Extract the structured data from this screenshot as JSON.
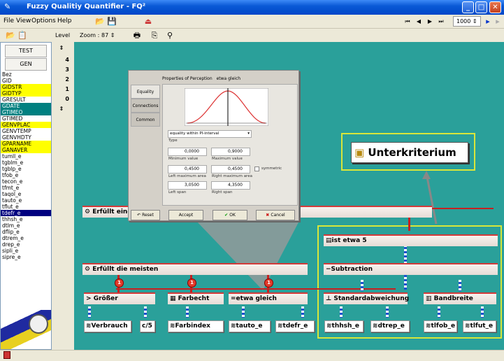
{
  "window": {
    "title": "Fuzzy Qualitiy Quantifier -  FQ²"
  },
  "menu": {
    "items": [
      "File",
      "View",
      "Options",
      "Help"
    ]
  },
  "toolbar": {
    "zoom_label": "Zoom :",
    "zoom_value": "87",
    "counter_value": "1000"
  },
  "left_panel": {
    "level_label": "Level",
    "test_button": "TEST",
    "gen_button": "GEN",
    "items": [
      {
        "label": "Bez",
        "style": "plain"
      },
      {
        "label": "GID",
        "style": "plain"
      },
      {
        "label": "GIDSTR",
        "style": "yellow"
      },
      {
        "label": "GIDTYP",
        "style": "yellow"
      },
      {
        "label": "GRESULT",
        "style": "plain"
      },
      {
        "label": "GDATE",
        "style": "teal"
      },
      {
        "label": "GTIMEO",
        "style": "teal"
      },
      {
        "label": "GTIMED",
        "style": "plain"
      },
      {
        "label": "GENVPLAC",
        "style": "yellow"
      },
      {
        "label": "GENVTEMP",
        "style": "plain"
      },
      {
        "label": "GENVHDTY",
        "style": "plain"
      },
      {
        "label": "GPARNAME",
        "style": "yellow"
      },
      {
        "label": "GANAVER",
        "style": "yellow"
      },
      {
        "label": "tumll_e",
        "style": "plain"
      },
      {
        "label": "tgblm_e",
        "style": "plain"
      },
      {
        "label": "tgblp_e",
        "style": "plain"
      },
      {
        "label": "tfob_e",
        "style": "plain"
      },
      {
        "label": "tecon_e",
        "style": "plain"
      },
      {
        "label": "tfmt_e",
        "style": "plain"
      },
      {
        "label": "taqol_e",
        "style": "plain"
      },
      {
        "label": "tauto_e",
        "style": "plain"
      },
      {
        "label": "tflut_e",
        "style": "plain"
      },
      {
        "label": "tdefr_e",
        "style": "selected"
      },
      {
        "label": "thhsh_e",
        "style": "plain"
      },
      {
        "label": "dtlm_e",
        "style": "plain"
      },
      {
        "label": "dflip_e",
        "style": "plain"
      },
      {
        "label": "dtrem_e",
        "style": "plain"
      },
      {
        "label": "drep_e",
        "style": "plain"
      },
      {
        "label": "sipli_e",
        "style": "plain"
      },
      {
        "label": "sipre_e",
        "style": "plain"
      }
    ],
    "levels": [
      "4",
      "3",
      "2",
      "1",
      "0"
    ]
  },
  "dialog": {
    "header": "Properties of Perception",
    "header_value": "etwa gleich",
    "tabs": [
      "Equality",
      "Connections",
      "Common"
    ],
    "type_select": "equality within PI-interval",
    "type_label": "Type",
    "min_value": "0,0000",
    "max_value": "0,9000",
    "min_label": "Minimum value",
    "max_label": "Maximum value",
    "left_max_area": "0,4500",
    "right_max_area": "0,4500",
    "symmetric_label": "symmetric",
    "left_max_area_label": "Left maximum area",
    "right_max_area_label": "Right maximum area",
    "left_span": "3,0500",
    "right_span": "4,3500",
    "left_span_label": "Left span",
    "right_span_label": "Right span",
    "reset_button": "Reset",
    "accept_button": "Accept",
    "ok_button": "OK",
    "cancel_button": "Cancel"
  },
  "canvas": {
    "unterkriterium": "Unterkriterium",
    "node_erfuellt_eine": "Erfüllt eine",
    "node_erfuellt_meisten": "Erfüllt die meisten",
    "node_ist_etwa": "ist etwa 5",
    "node_subtraction": "Subtraction",
    "node_groesser": "Größer",
    "node_farbecht": "Farbecht",
    "node_etwa_gleich": "etwa gleich",
    "node_std": "Standardabweichung",
    "node_bandbreite": "Bandbreite",
    "leaf_verbrauch": "Verbrauch",
    "leaf_5": "5",
    "leaf_farbindex": "Farbindex",
    "leaf_tauto": "tauto_e",
    "leaf_tdefr": "tdefr_e",
    "leaf_thhsh": "thhsh_e",
    "leaf_dtrep": "dtrep_e",
    "leaf_tlfob": "tlfob_e",
    "leaf_tlfut": "tlfut_e",
    "badge": "1"
  },
  "colors": {
    "canvas": "#2aa09a",
    "frame": "#d8e63a",
    "titlebar": "#0a5ad6"
  }
}
